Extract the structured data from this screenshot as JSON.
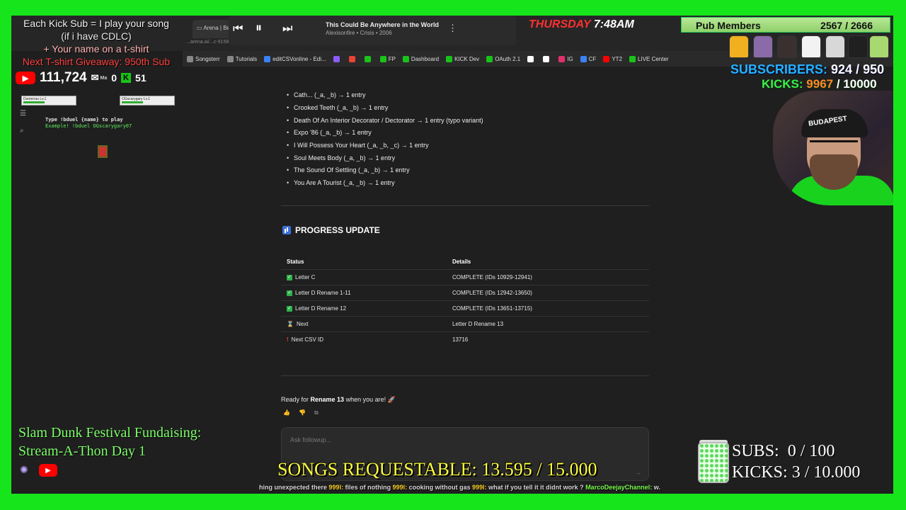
{
  "browser": {
    "tabs": [
      "Arena | Be"
    ],
    "url_fragment": "...arena.ai/...c-9158839332e5",
    "bookmarks": [
      {
        "label": "Songsterr",
        "color": "#888"
      },
      {
        "label": "Tutorials",
        "color": "#888"
      },
      {
        "label": "editCSVonline - Edi...",
        "color": "#3b82f6"
      },
      {
        "label": "",
        "color": "#8b5cf6"
      },
      {
        "label": "",
        "color": "#ea4335"
      },
      {
        "label": "",
        "color": "#19c319"
      },
      {
        "label": "FP",
        "color": "#19c319"
      },
      {
        "label": "Dashboard",
        "color": "#19c319"
      },
      {
        "label": "KICK Dev",
        "color": "#19c319"
      },
      {
        "label": "OAuth 2.1",
        "color": "#19c319"
      },
      {
        "label": "",
        "color": "#fff"
      },
      {
        "label": "",
        "color": "#fff"
      },
      {
        "label": "IG",
        "color": "#e1306c"
      },
      {
        "label": "CF",
        "color": "#3b82f6"
      },
      {
        "label": "YT2",
        "color": "#ff0000"
      },
      {
        "label": "LIVE Center",
        "color": "#19c319"
      }
    ]
  },
  "media": {
    "title": "This Could Be Anywhere in the World",
    "subtitle": "Alexisonfire • Crisis • 2006",
    "prev_icon": "skip-previous-icon",
    "pause_icon": "pause-icon",
    "next_icon": "skip-next-icon"
  },
  "clock": {
    "day": "THURSDAY",
    "time": "7:48AM"
  },
  "pub_members": {
    "label": "Pub Members",
    "count": "2567 / 2666"
  },
  "subscribers_top": {
    "label": "SUBSCRIBERS:",
    "value": "924 / 950"
  },
  "kicks_top": {
    "label": "KICKS:",
    "current": "9967",
    "target": "/ 10000"
  },
  "webcam": {
    "cap_text": "BUDAPEST"
  },
  "overlay_left": {
    "line1": "Each Kick Sub = I play your song",
    "line2": "(if i have CDLC)",
    "line3": "+ Your name on a t-shirt",
    "line4": "Next T-shirt Giveaway: 950th Sub",
    "youtube_count": "111,724",
    "mail_label": "Ma",
    "mail_count": "0",
    "kick_count": "51"
  },
  "game": {
    "player1": "Dumerras",
    "player2": "OGscarygary",
    "level": "Lv.1",
    "line1": "Type !bduel {name} to play",
    "line2": "Example! !bduel OGscarygary07"
  },
  "fundraiser": {
    "line1": "Slam Dunk Festival Fundaising:",
    "line2": "Stream-A-Thon Day 1"
  },
  "article": {
    "bullets": [
      "Cath... (_a, _b) → 1 entry",
      "Crooked Teeth (_a, _b) → 1 entry",
      "Death Of An Interior Decorator / Dectorator → 1 entry (typo variant)",
      "Expo '86 (_a, _b) → 1 entry",
      "I Will Possess Your Heart (_a, _b, _c) → 1 entry",
      "Soul Meets Body (_a, _b) → 1 entry",
      "The Sound Of Settling (_a, _b) → 1 entry",
      "You Are A Tourist (_a, _b) → 1 entry"
    ],
    "heading": "PROGRESS UPDATE",
    "table": {
      "headers": [
        "Status",
        "Details"
      ],
      "rows": [
        {
          "icon": "check-icon",
          "status": "Letter C",
          "details": "COMPLETE (IDs 10929-12941)"
        },
        {
          "icon": "check-icon",
          "status": "Letter D Rename 1-11",
          "details": "COMPLETE (IDs 12942-13650)"
        },
        {
          "icon": "check-icon",
          "status": "Letter D Rename 12",
          "details": "COMPLETE (IDs 13651-13715)"
        },
        {
          "icon": "hourglass-icon",
          "status": "Next",
          "details": "Letter D Rename 13"
        },
        {
          "icon": "exclamation-icon",
          "status": "Next CSV ID",
          "details": "13716"
        }
      ]
    },
    "ready_prefix": "Ready for ",
    "ready_bold": "Rename 13",
    "ready_suffix": " when you are! 🚀",
    "followup_placeholder": "Ask followup..."
  },
  "songs_requestable": "SONGS REQUESTABLE: 13.595 / 15.000",
  "ticker": [
    {
      "user": "",
      "text": "hing unexpected there"
    },
    {
      "user": "999l:",
      "text": "files of nothing"
    },
    {
      "user": "999l:",
      "text": "cooking without gas"
    },
    {
      "user": "999l:",
      "text": "what if you tell it it didnt work ?"
    },
    {
      "user": "MarcoDeejayChannel:",
      "text": "w."
    }
  ],
  "goals_bottom": {
    "subs_label": "SUBS:",
    "subs_value": "0 / 100",
    "kicks_label": "KICKS:",
    "kicks_value": "3 / 10.000"
  },
  "colors": {
    "green_screen": "#17e51c",
    "accent_yellow": "#ffff40",
    "subs_blue": "#24b3ff"
  }
}
